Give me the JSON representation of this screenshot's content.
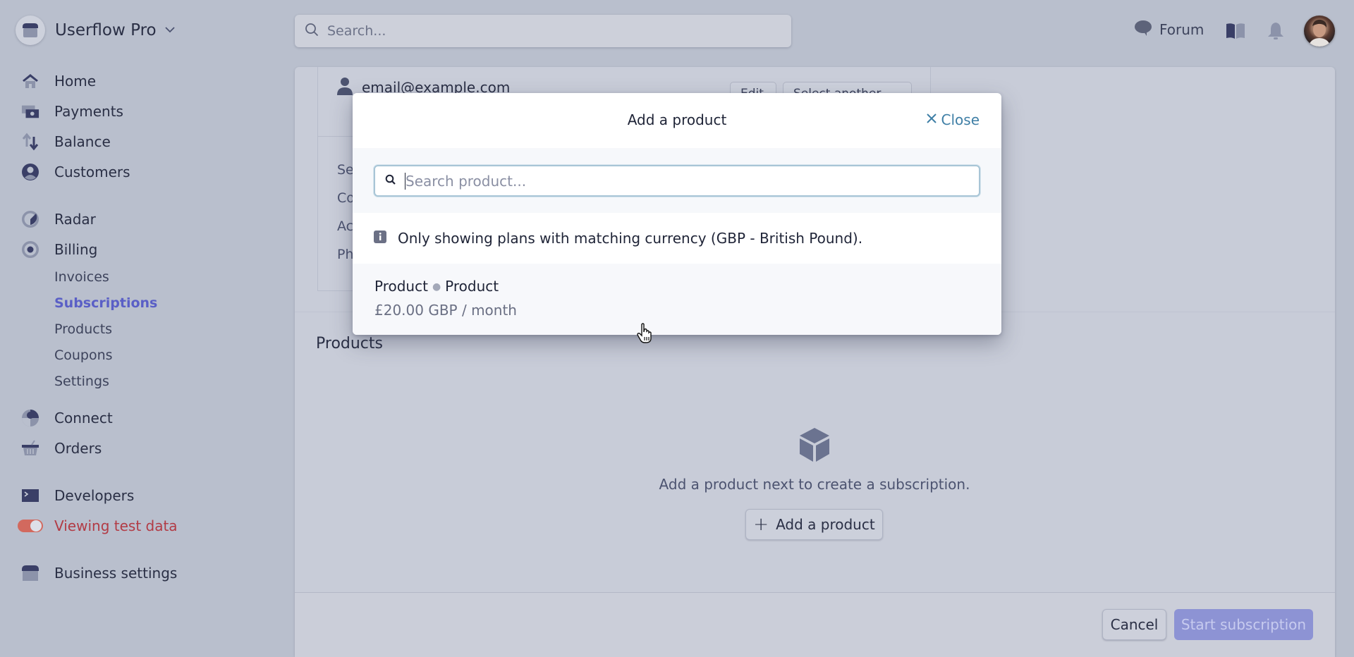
{
  "brand": {
    "name": "Userflow Pro"
  },
  "sidebar": {
    "items": [
      {
        "label": "Home",
        "icon": "home-icon"
      },
      {
        "label": "Payments",
        "icon": "payments-icon"
      },
      {
        "label": "Balance",
        "icon": "balance-icon"
      },
      {
        "label": "Customers",
        "icon": "customers-icon"
      },
      {
        "label": "Radar",
        "icon": "radar-icon"
      },
      {
        "label": "Billing",
        "icon": "billing-icon"
      },
      {
        "label": "Connect",
        "icon": "connect-icon"
      },
      {
        "label": "Orders",
        "icon": "orders-icon"
      },
      {
        "label": "Developers",
        "icon": "developers-icon"
      },
      {
        "label": "Viewing test data",
        "icon": "toggle-icon"
      },
      {
        "label": "Business settings",
        "icon": "business-icon"
      }
    ],
    "billing_sub": [
      {
        "label": "Invoices",
        "active": false
      },
      {
        "label": "Subscriptions",
        "active": true
      },
      {
        "label": "Products",
        "active": false
      },
      {
        "label": "Coupons",
        "active": false
      },
      {
        "label": "Settings",
        "active": false
      }
    ],
    "test_data_toggle": {
      "on": true
    }
  },
  "topbar": {
    "search_placeholder": "Search...",
    "forum_label": "Forum"
  },
  "customer": {
    "email": "email@example.com",
    "edit_label": "Edit",
    "select_another_label": "Select another",
    "field_labels_partial": [
      "Se",
      "Co",
      "Ac",
      "Ph"
    ]
  },
  "products_section": {
    "title": "Products",
    "empty_text": "Add a product next to create a subscription.",
    "add_button": "Add a product"
  },
  "footer": {
    "cancel": "Cancel",
    "start": "Start subscription"
  },
  "modal": {
    "title": "Add a product",
    "close_label": "Close",
    "search_placeholder": "Search product...",
    "info_text": "Only showing plans with matching currency (GBP - British Pound).",
    "products": [
      {
        "name": "Product",
        "plan": "Product",
        "price": "£20.00 GBP / month"
      }
    ]
  },
  "colors": {
    "accent": "#5a5fc6",
    "test_data": "#b23b45",
    "close_link": "#3f7fa6",
    "start_button": "#8d93d4"
  }
}
